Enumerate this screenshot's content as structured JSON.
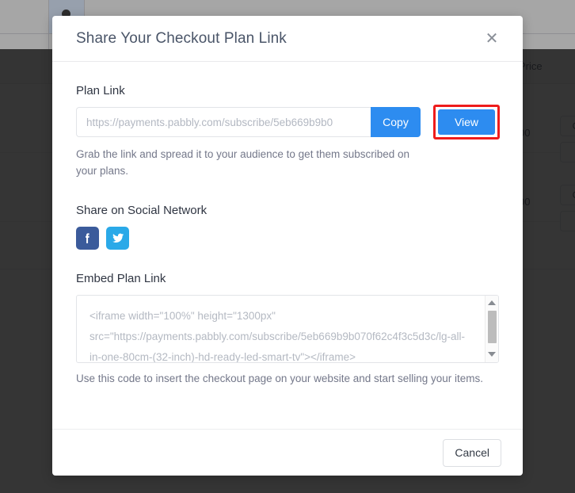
{
  "modal": {
    "title": "Share Your Checkout Plan Link",
    "close_icon": "close-icon",
    "plan_link": {
      "label": "Plan Link",
      "value": "https://payments.pabbly.com/subscribe/5eb669b9b0",
      "placeholder": "https://payments.pabbly.com/subscribe/5eb669b9b0",
      "copy_label": "Copy",
      "view_label": "View",
      "helper": "Grab the link and spread it to your audience to get them subscribed on your plans."
    },
    "social": {
      "label": "Share on Social Network",
      "items": [
        {
          "name": "facebook-icon",
          "glyph": "f",
          "color": "#3b5b9b"
        },
        {
          "name": "twitter-icon",
          "glyph": "t",
          "color": "#2aa9e8"
        }
      ]
    },
    "embed": {
      "label": "Embed Plan Link",
      "value": "<iframe width=\"100%\" height=\"1300px\" src=\"https://payments.pabbly.com/subscribe/5eb669b9b070f62c4f3c5d3c/lg-all-in-one-80cm-(32-inch)-hd-ready-led-smart-tv\"></iframe>",
      "helper": "Use this code to insert the checkout page on your website and start selling your items."
    },
    "footer": {
      "cancel_label": "Cancel"
    },
    "highlight_color": "#ee1c1c",
    "accent_color": "#2d8cf0"
  },
  "background": {
    "table_header": "Price",
    "rows": [
      {
        "price": "00",
        "action": "C"
      },
      {
        "price": "00",
        "action": "C"
      }
    ]
  }
}
